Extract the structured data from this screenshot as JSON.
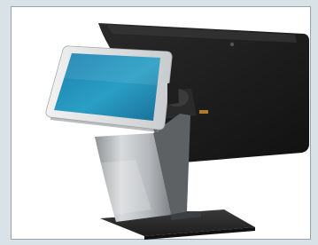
{
  "image": {
    "subject": "dual-screen-pos-terminal",
    "colors": {
      "page_background": "#d9e3e7",
      "panel_background": "#ffffff",
      "panel_border": "#9aa4a8",
      "rear_screen": "#1b1b1b",
      "front_display": "#2a9fc5",
      "stand_silver": "#c7c9cb",
      "stand_dark": "#2d2d2d",
      "base": "#2a2a2a"
    }
  }
}
